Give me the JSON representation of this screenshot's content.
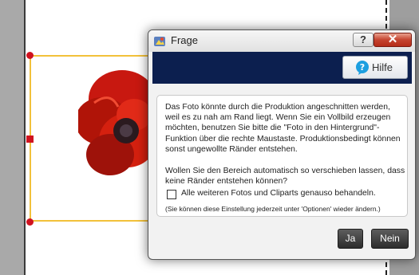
{
  "dialog": {
    "title": "Frage",
    "help_glyph": "?",
    "close_glyph": "✕",
    "hilfe_label": "Hilfe",
    "paragraph1": "Das Foto könnte durch die Produktion angeschnitten werden, weil es zu nah am Rand liegt. Wenn Sie ein Vollbild erzeugen möchten, benutzen Sie bitte die \"Foto in den Hintergrund\"-Funktion über die rechte Maustaste. Produktionsbedingt können sonst ungewollte Ränder entstehen.",
    "paragraph2": "Wollen Sie den Bereich automatisch so verschieben lassen, dass keine Ränder entstehen können?",
    "checkbox_label": "Alle weiteren Fotos und Cliparts genauso behandeln.",
    "checkbox_checked": false,
    "hint": "(Sie können diese Einstellung jederzeit unter 'Optionen' wieder ändern.)",
    "yes_label": "Ja",
    "no_label": "Nein"
  },
  "icons": {
    "app": "app-icon",
    "help": "help-icon",
    "close": "close-icon",
    "hilfe": "question-bubble-icon"
  },
  "colors": {
    "banner": "#0c1f4f",
    "selection_frame": "#f2c13a",
    "handles": "#d0121f",
    "close_button": "#c5432f",
    "action_buttons": "#3a3a3a"
  }
}
